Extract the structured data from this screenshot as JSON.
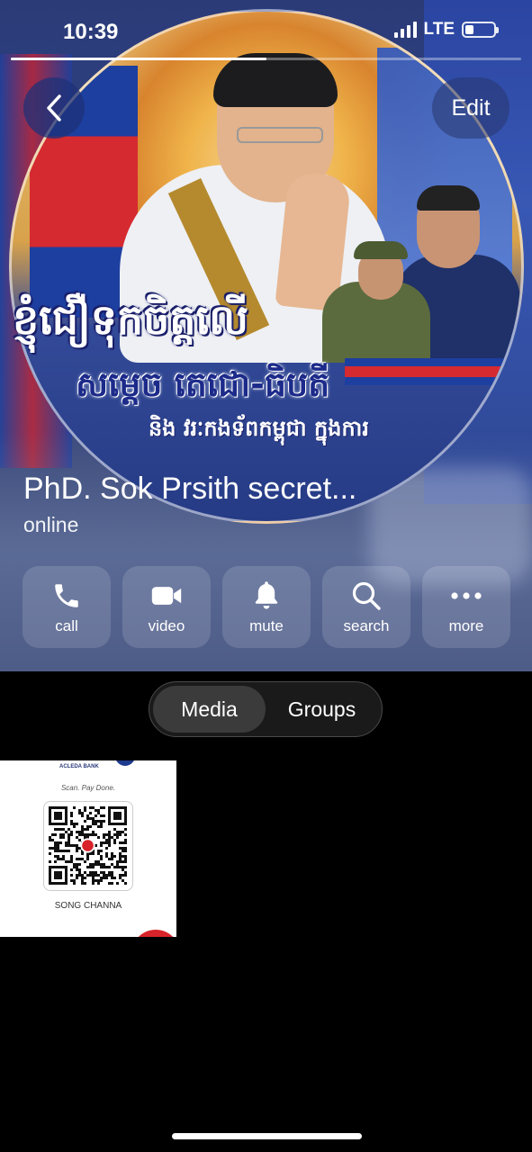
{
  "status_bar": {
    "time": "10:39",
    "network": "LTE",
    "battery_level": 0.3
  },
  "story_progress": 0.5,
  "nav": {
    "back_icon": "chevron-left-icon",
    "edit_label": "Edit"
  },
  "profile_photo": {
    "khmer_line_1": "ខ្ញុំជឿទុកចិត្តលើ",
    "khmer_line_2": "សម្ដេច តេជោ-ធិបតី",
    "khmer_line_3": "និង វរៈកងទ័ពកម្ពុជា ក្នុងការ"
  },
  "contact": {
    "name": "PhD. Sok Prsith secret...",
    "status": "online"
  },
  "actions": [
    {
      "label": "call",
      "icon": "phone-icon"
    },
    {
      "label": "video",
      "icon": "video-camera-icon"
    },
    {
      "label": "mute",
      "icon": "bell-icon"
    },
    {
      "label": "search",
      "icon": "search-icon"
    },
    {
      "label": "more",
      "icon": "more-dots-icon"
    }
  ],
  "tabs": [
    {
      "label": "Media",
      "active": true
    },
    {
      "label": "Groups",
      "active": false
    }
  ],
  "media": [
    {
      "bank_name": "ACLEDA BANK",
      "tagline": "Scan. Pay Done.",
      "owner": "SONG CHANNA"
    }
  ],
  "colors": {
    "background": "#000000",
    "header_blue": "#314487",
    "button_bg": "rgba(255,255,255,0.14)",
    "active_tab": "#3b3b3b"
  }
}
